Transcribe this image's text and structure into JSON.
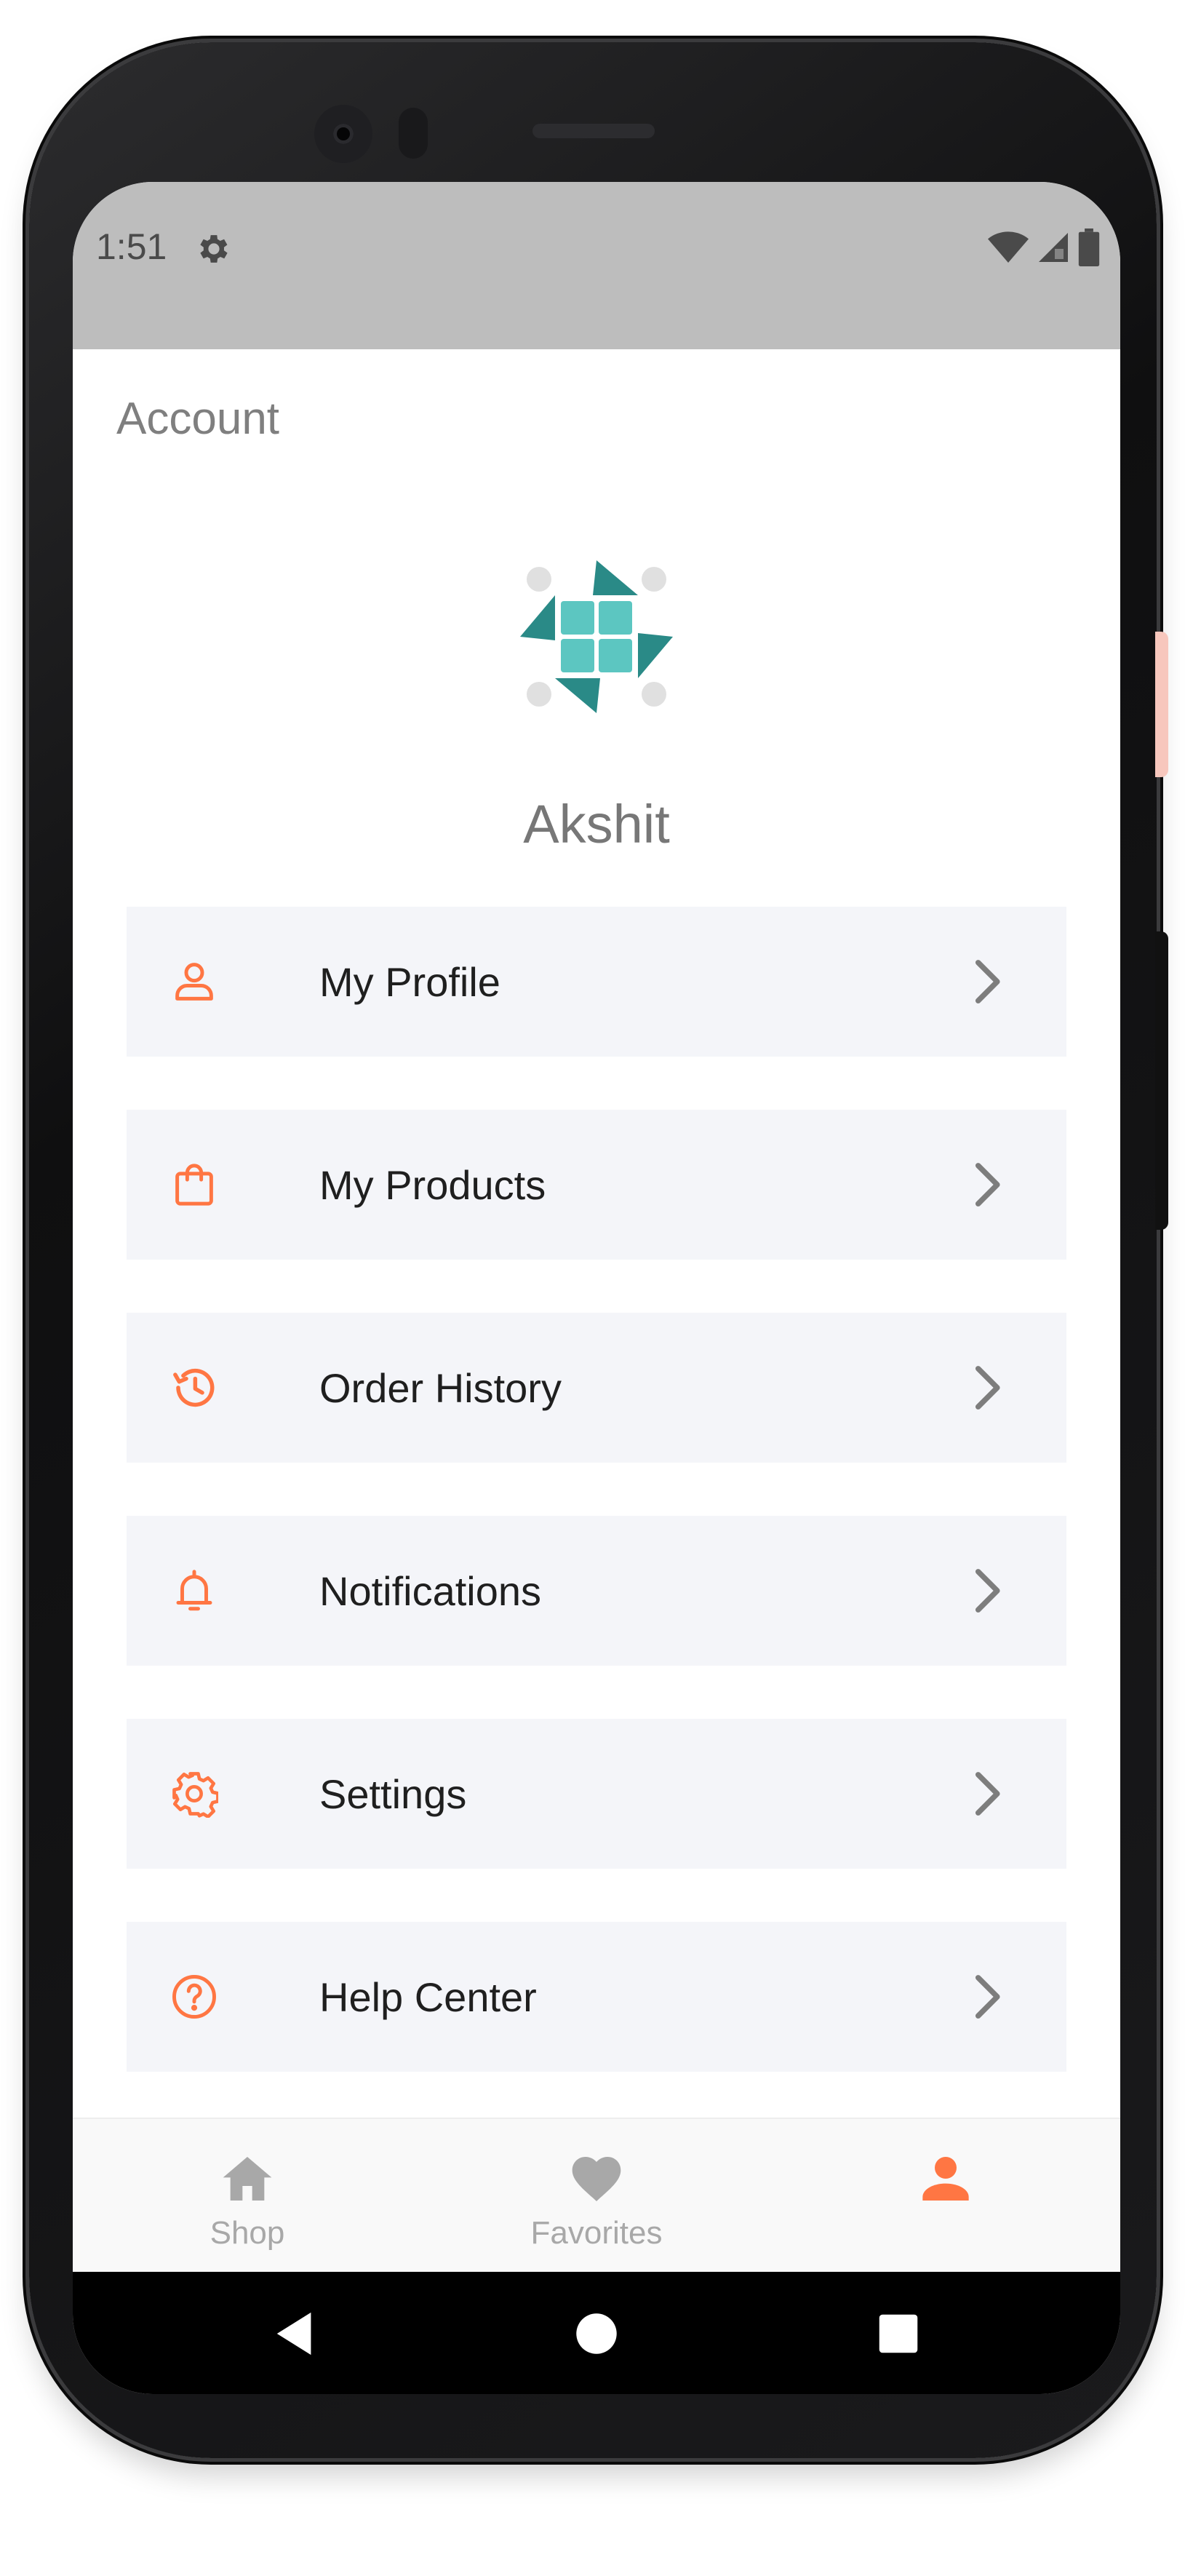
{
  "status_bar": {
    "time": "1:51",
    "icons": [
      "gear-icon",
      "wifi-icon",
      "cell-signal-icon",
      "battery-icon"
    ]
  },
  "header": {
    "title": "Account"
  },
  "profile": {
    "name": "Akshit",
    "avatar_icon": "pinwheel-logo-icon"
  },
  "menu": {
    "items": [
      {
        "label": "My Profile",
        "icon": "person-icon"
      },
      {
        "label": "My Products",
        "icon": "shopping-bag-icon"
      },
      {
        "label": "Order History",
        "icon": "history-icon"
      },
      {
        "label": "Notifications",
        "icon": "bell-icon"
      },
      {
        "label": "Settings",
        "icon": "gear-icon"
      },
      {
        "label": "Help Center",
        "icon": "help-circle-icon"
      }
    ]
  },
  "bottom_nav": {
    "items": [
      {
        "label": "Shop",
        "icon": "home-icon",
        "active": false
      },
      {
        "label": "Favorites",
        "icon": "heart-icon",
        "active": false
      },
      {
        "label": "",
        "icon": "person-icon",
        "active": true
      }
    ]
  },
  "system_nav": {
    "buttons": [
      "back-icon",
      "home-circle-icon",
      "recents-square-icon"
    ]
  },
  "colors": {
    "accent": "#ff7643",
    "menu_background": "#f4f5f9",
    "status_bar": "#bdbdbd",
    "inactive_nav": "#a8a8a8",
    "chevron": "#7d7d7d",
    "logo_dark_teal": "#2a8a87",
    "logo_light_teal": "#5cc6c1"
  }
}
